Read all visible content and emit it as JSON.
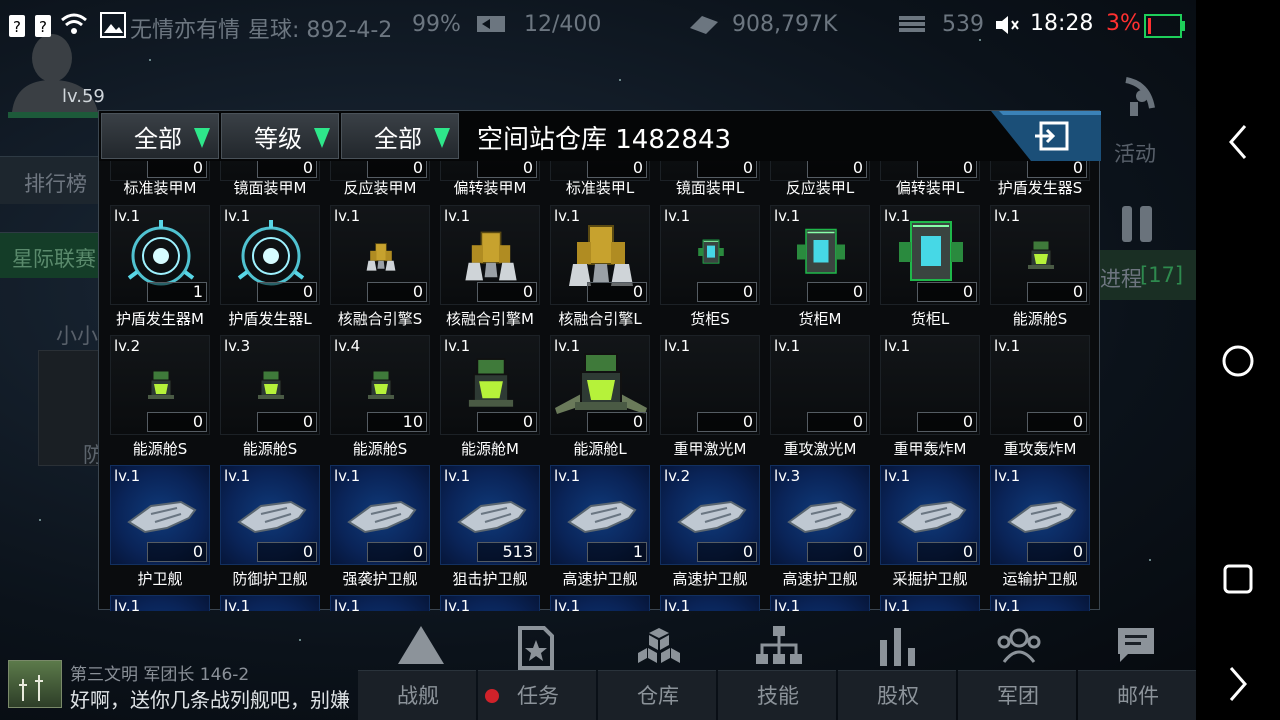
{
  "status_bar": {
    "player": "无情亦有情",
    "planet": "星球: 892-4-2",
    "percent": "99%",
    "fleet": "12/400",
    "credits": "908,797K",
    "resource": "539",
    "time": "18:28",
    "battery": "3%"
  },
  "player": {
    "level": "lv.59"
  },
  "background": {
    "rank": "排行榜",
    "league": "星际联赛",
    "small": "小小",
    "defense": "防",
    "activity": "活动",
    "progress_label": "进程",
    "progress_count": "[17]"
  },
  "chat": {
    "header": "第三文明 军团长 146-2",
    "message": "好啊，送你几条战列舰吧，别嫌"
  },
  "dialog": {
    "filters": [
      "全部",
      "等级",
      "全部"
    ],
    "title": "空间站仓库 1482843"
  },
  "warehouse": {
    "row0": {
      "counts": [
        "0",
        "0",
        "0",
        "0",
        "0",
        "0",
        "0",
        "0",
        "0"
      ],
      "names": [
        "标准装甲M",
        "镜面装甲M",
        "反应装甲M",
        "偏转装甲M",
        "标准装甲L",
        "镜面装甲L",
        "反应装甲L",
        "偏转装甲L",
        "护盾发生器S"
      ]
    },
    "row1": {
      "levels": [
        "lv.1",
        "lv.1",
        "lv.1",
        "lv.1",
        "lv.1",
        "lv.1",
        "lv.1",
        "lv.1",
        "lv.1"
      ],
      "counts": [
        "1",
        "0",
        "0",
        "0",
        "0",
        "0",
        "0",
        "0",
        "0"
      ],
      "names": [
        "护盾发生器M",
        "护盾发生器L",
        "核融合引擎S",
        "核融合引擎M",
        "核融合引擎L",
        "货柜S",
        "货柜M",
        "货柜L",
        "能源舱S"
      ],
      "icons": [
        "shield-generator-m",
        "shield-generator-l",
        "fusion-engine-s",
        "fusion-engine-m",
        "fusion-engine-l",
        "container-s",
        "container-m",
        "container-l",
        "energy-pod-s"
      ]
    },
    "row2": {
      "levels": [
        "lv.2",
        "lv.3",
        "lv.4",
        "lv.1",
        "lv.1",
        "lv.1",
        "lv.1",
        "lv.1",
        "lv.1"
      ],
      "counts": [
        "0",
        "0",
        "10",
        "0",
        "0",
        "0",
        "0",
        "0",
        "0"
      ],
      "names": [
        "能源舱S",
        "能源舱S",
        "能源舱S",
        "能源舱M",
        "能源舱L",
        "重甲激光M",
        "重攻激光M",
        "重甲轰炸M",
        "重攻轰炸M"
      ],
      "icons": [
        "energy-pod-s",
        "energy-pod-s",
        "energy-pod-s",
        "energy-pod-m",
        "energy-pod-l",
        "",
        "",
        "",
        ""
      ]
    },
    "row3": {
      "levels": [
        "lv.1",
        "lv.1",
        "lv.1",
        "lv.1",
        "lv.1",
        "lv.2",
        "lv.3",
        "lv.1",
        "lv.1"
      ],
      "counts": [
        "0",
        "0",
        "0",
        "513",
        "1",
        "0",
        "0",
        "0",
        "0"
      ],
      "names": [
        "护卫舰",
        "防御护卫舰",
        "强袭护卫舰",
        "狙击护卫舰",
        "高速护卫舰",
        "高速护卫舰",
        "高速护卫舰",
        "采掘护卫舰",
        "运输护卫舰"
      ]
    },
    "row4": {
      "levels": [
        "lv.1",
        "lv.1",
        "lv.1",
        "lv.1",
        "lv.1",
        "lv.1",
        "lv.1",
        "lv.1",
        "lv.1"
      ]
    }
  },
  "bottom_tabs": [
    "战舰",
    "任务",
    "仓库",
    "技能",
    "股权",
    "军团",
    "邮件"
  ],
  "colors": {
    "accent": "#2ee68a",
    "battery_low": "#ff3030",
    "ship_bg": "#0a2458"
  }
}
